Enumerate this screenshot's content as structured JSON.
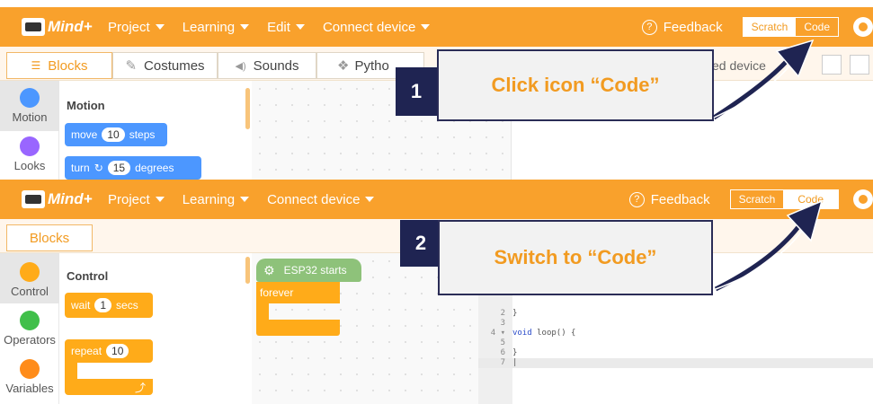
{
  "colors": {
    "accent": "#f9a12c",
    "callout_text": "#f29b21",
    "badge_bg": "#1f2452",
    "motion": "#4c97ff",
    "looks": "#9966ff",
    "control": "#ffab19",
    "operators": "#40bf4a",
    "variables": "#ff8c1a",
    "esp32": "#8ec27a"
  },
  "app": {
    "brand": "Mind+"
  },
  "panel1": {
    "menu": [
      "Project",
      "Learning",
      "Edit",
      "Connect device"
    ],
    "feedback": "Feedback",
    "toggle": {
      "scratch": "Scratch",
      "code": "Code"
    },
    "tabs": [
      "Blocks",
      "Costumes",
      "Sounds",
      "Pytho"
    ],
    "connected_text": "ed device",
    "categories": [
      {
        "label": "Motion",
        "icon": "motion-dot-icon"
      },
      {
        "label": "Looks",
        "icon": "looks-dot-icon"
      }
    ],
    "palette_title": "Motion",
    "blocks": {
      "move_pre": "move",
      "move_val": "10",
      "move_post": "steps",
      "turn_pre": "turn",
      "turn_val": "15",
      "turn_post": "degrees"
    },
    "callout": {
      "number": "1",
      "text": "Click icon “Code”"
    }
  },
  "panel2": {
    "menu": [
      "Project",
      "Learning",
      "Connect device"
    ],
    "feedback": "Feedback",
    "toggle": {
      "scratch": "Scratch",
      "code": "Code"
    },
    "tabs": [
      "Blocks"
    ],
    "categories": [
      {
        "label": "Control",
        "icon": "control-dot-icon"
      },
      {
        "label": "Operators",
        "icon": "operators-dot-icon"
      },
      {
        "label": "Variables",
        "icon": "variables-dot-icon"
      }
    ],
    "palette_title": "Control",
    "blocks": {
      "wait_pre": "wait",
      "wait_val": "1",
      "wait_post": "secs",
      "repeat_pre": "repeat",
      "repeat_val": "10"
    },
    "workspace_blocks": {
      "hat": "ESP32 starts",
      "forever": "forever"
    },
    "code_lines": [
      {
        "n": "2",
        "text": "}"
      },
      {
        "n": "3",
        "text": ""
      },
      {
        "n": "4 ▾",
        "kw": "void",
        "text": " loop() {"
      },
      {
        "n": "5",
        "text": ""
      },
      {
        "n": "6",
        "text": "}"
      },
      {
        "n": "7",
        "text": "|"
      }
    ],
    "callout": {
      "number": "2",
      "text": "Switch to “Code”"
    }
  }
}
